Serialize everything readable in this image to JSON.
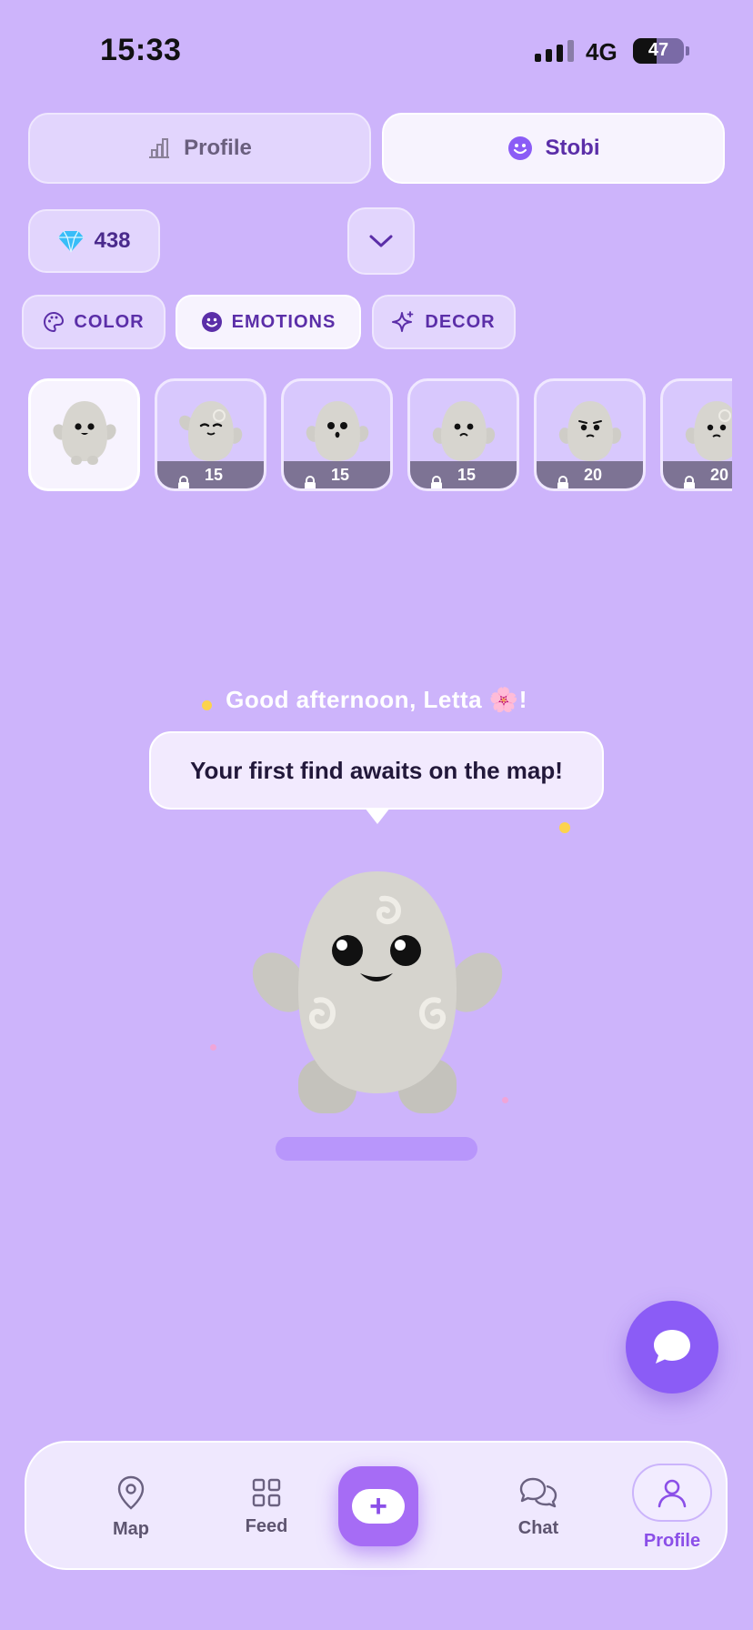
{
  "status_bar": {
    "time": "15:33",
    "network": "4G",
    "battery": "47",
    "battery_fraction": 0.47
  },
  "top_tabs": [
    {
      "label": "Profile",
      "icon": "bar-chart-icon",
      "active": false
    },
    {
      "label": "Stobi",
      "icon": "smiley-icon",
      "active": true
    }
  ],
  "gems": {
    "count": "438",
    "icon": "gem-icon"
  },
  "categories": [
    {
      "label": "COLOR",
      "icon": "palette-icon",
      "active": false
    },
    {
      "label": "EMOTIONS",
      "icon": "smiley-icon",
      "active": true
    },
    {
      "label": "DECOR",
      "icon": "sparkle-icon",
      "active": false
    }
  ],
  "emotions": [
    {
      "selected": true,
      "locked": false,
      "price": ""
    },
    {
      "selected": false,
      "locked": true,
      "price": "15"
    },
    {
      "selected": false,
      "locked": true,
      "price": "15"
    },
    {
      "selected": false,
      "locked": true,
      "price": "15"
    },
    {
      "selected": false,
      "locked": true,
      "price": "20"
    },
    {
      "selected": false,
      "locked": true,
      "price": "20"
    }
  ],
  "greeting": {
    "text": "Good afternoon, Letta 🌸!"
  },
  "bubble": {
    "text": "Your first find awaits on the map!"
  },
  "nav": {
    "map": "Map",
    "feed": "Feed",
    "chat": "Chat",
    "profile": "Profile"
  },
  "colors": {
    "background": "#cdb4fb",
    "accent": "#8b5cf6",
    "accent_dark": "#5b2ea8"
  }
}
